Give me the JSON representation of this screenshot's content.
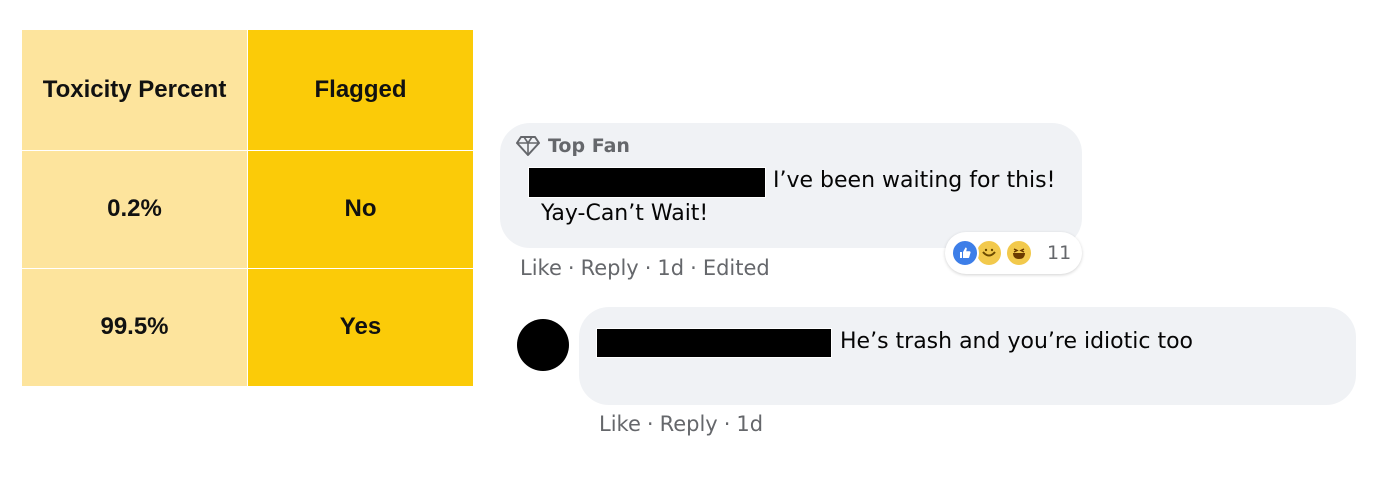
{
  "table": {
    "headers": [
      "Toxicity Percent",
      "Flagged"
    ],
    "rows": [
      {
        "toxicity": "0.2%",
        "flagged": "No"
      },
      {
        "toxicity": "99.5%",
        "flagged": "Yes"
      }
    ],
    "colors": {
      "light": "#fde49d",
      "dark": "#fbcb08"
    }
  },
  "comments": [
    {
      "badge": "Top Fan",
      "badge_icon": "diamond-icon",
      "author_redacted": true,
      "text_line1": "I’ve been waiting for this!",
      "text_line2": "Yay-Can’t Wait!",
      "reactions": {
        "icons": [
          "like-icon",
          "care-icon",
          "haha-icon"
        ],
        "count": "11"
      },
      "actions": {
        "like": "Like",
        "reply": "Reply",
        "time": "1d",
        "edited": "Edited",
        "separator": "·"
      }
    },
    {
      "author_redacted": true,
      "avatar": "avatar",
      "text": "He’s trash and you’re idiotic too",
      "actions": {
        "like": "Like",
        "reply": "Reply",
        "time": "1d",
        "separator": "·"
      }
    }
  ]
}
